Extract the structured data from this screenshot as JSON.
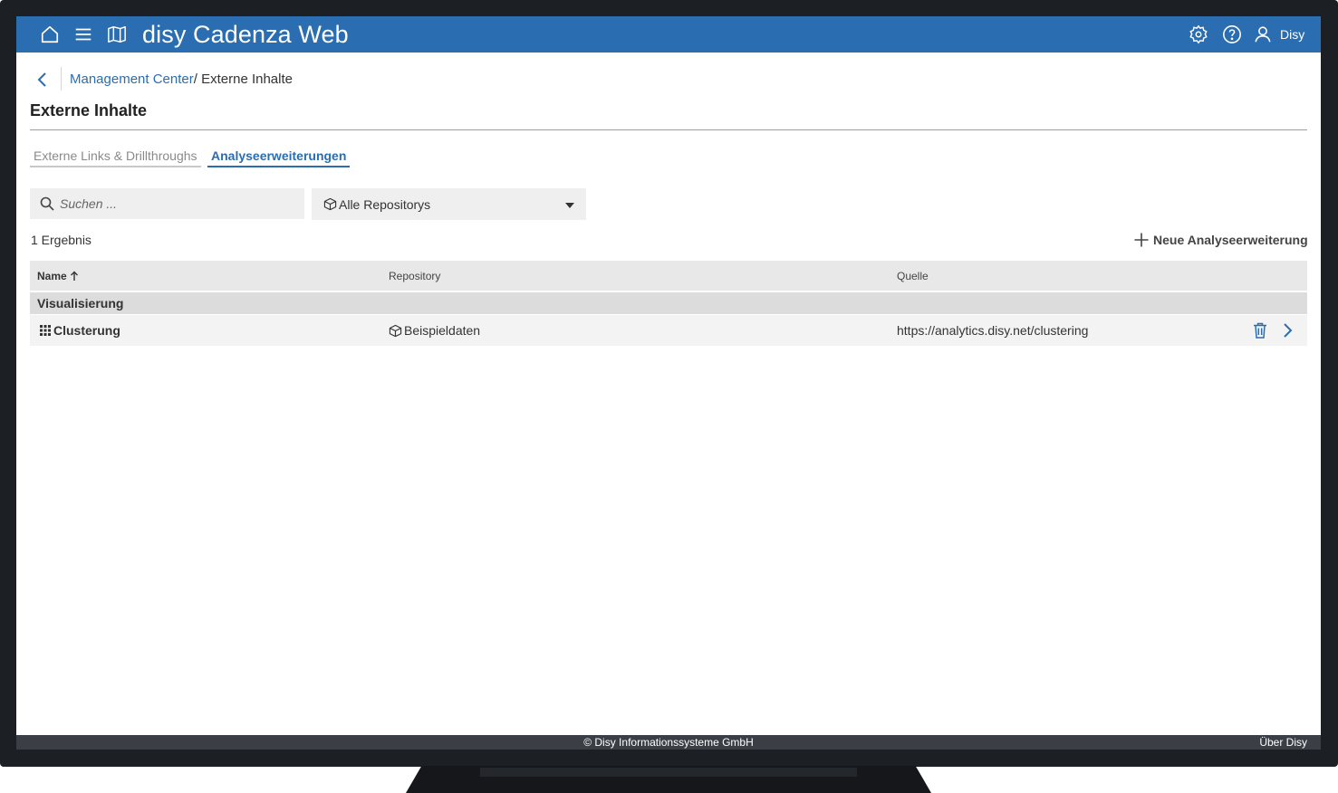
{
  "header": {
    "app_title": "disy Cadenza Web",
    "user_name": "Disy",
    "colors": {
      "brand": "#2b6db1"
    },
    "icons": [
      "home-icon",
      "menu-icon",
      "map-icon",
      "gear-icon",
      "help-icon",
      "user-icon"
    ]
  },
  "breadcrumb": {
    "parent": "Management Center",
    "separator": "/",
    "current": "Externe Inhalte"
  },
  "page": {
    "title": "Externe Inhalte"
  },
  "tabs": [
    {
      "label": "Externe Links & Drillthroughs",
      "active": false
    },
    {
      "label": "Analyseerweiterungen",
      "active": true
    }
  ],
  "filters": {
    "search_placeholder": "Suchen ...",
    "repository_selected": "Alle Repositorys"
  },
  "results": {
    "count_label": "1 Ergebnis",
    "new_button_label": "Neue Analyseerweiterung"
  },
  "table": {
    "columns": [
      "Name",
      "Repository",
      "Quelle"
    ],
    "sort_column": "Name",
    "sort_direction": "ascending",
    "groups": [
      {
        "label": "Visualisierung",
        "rows": [
          {
            "name": "Clusterung",
            "repository": "Beispieldaten",
            "source": "https://analytics.disy.net/clustering"
          }
        ]
      }
    ]
  },
  "footer": {
    "copyright": "© Disy Informationssysteme GmbH",
    "about_link": "Über Disy"
  }
}
